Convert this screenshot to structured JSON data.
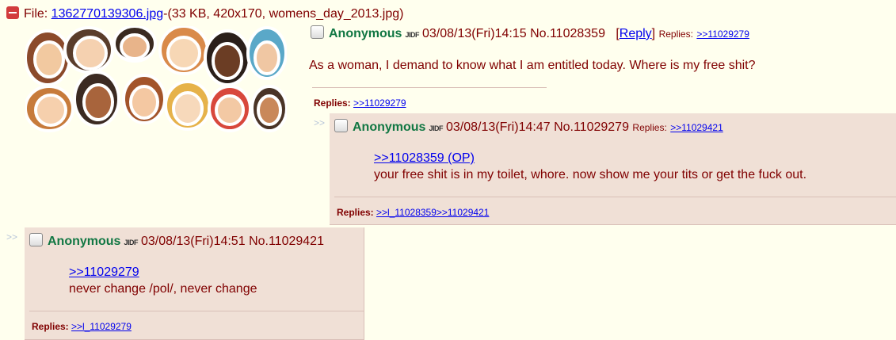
{
  "op": {
    "file_label": "File: ",
    "file_link": "1362770139306.jpg",
    "file_info": "-(33 KB, 420x170, womens_day_2013.jpg)",
    "name": "Anonymous",
    "flag": "JIDF",
    "datetime": "03/08/13(Fri)14:15",
    "post_no": "No.11028359",
    "reply_open": "[",
    "reply_link": "Reply",
    "reply_close": "]",
    "replies_label": "Replies:",
    "replies_link": ">>11029279",
    "body": "As a woman, I demand to know what I am entitled today. Where is my free shit?",
    "bottom_replies_label": "Replies:",
    "bottom_replies_link": ">>11029279"
  },
  "reply1": {
    "arrows": ">>",
    "name": "Anonymous",
    "flag": "JIDF",
    "datetime": "03/08/13(Fri)14:47",
    "post_no": "No.11029279",
    "replies_label": "Replies:",
    "replies_link": ">>11029421",
    "quote": ">>11028359 (OP)",
    "body": "your free shit is in my toilet, whore. now show me your tits or get the fuck out.",
    "bottom_replies_label": "Replies:",
    "bottom_replies_link": ">>l_11028359>>11029421"
  },
  "reply2": {
    "arrows": ">>",
    "name": "Anonymous",
    "flag": "JIDF",
    "datetime": "03/08/13(Fri)14:51",
    "post_no": "No.11029421",
    "quote": ">>11029279",
    "body": "never change /pol/, never change",
    "bottom_replies_label": "Replies:",
    "bottom_replies_link": ">>l_11029279"
  }
}
